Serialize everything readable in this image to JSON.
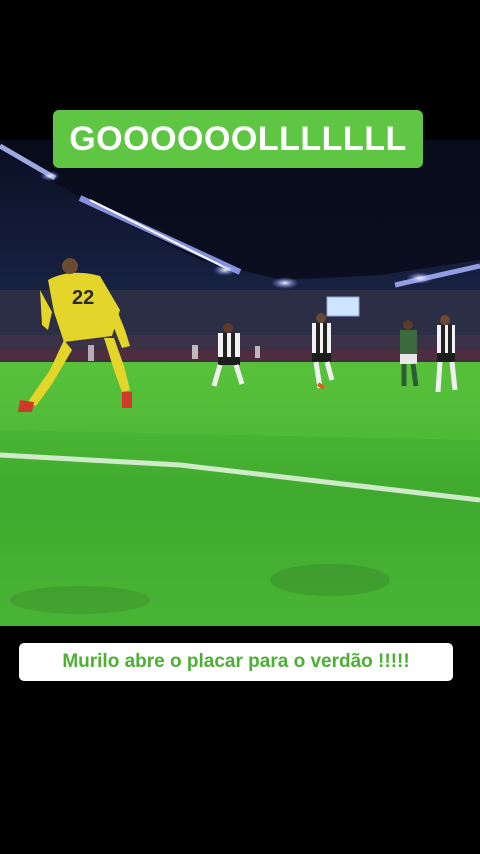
{
  "overlay": {
    "headline": "GOOOOOOLLLLLLL",
    "caption": "Murilo abre o placar para o verdão !!!!!"
  },
  "photo": {
    "goalkeeper_number": "22"
  },
  "colors": {
    "headline_bg": "#5fc644",
    "headline_text": "#ffffff",
    "caption_bg": "#ffffff",
    "caption_text": "#4cb033",
    "pitch": "#3fae2f",
    "sky": "#10162e",
    "keeper_kit": "#e2d42a"
  }
}
